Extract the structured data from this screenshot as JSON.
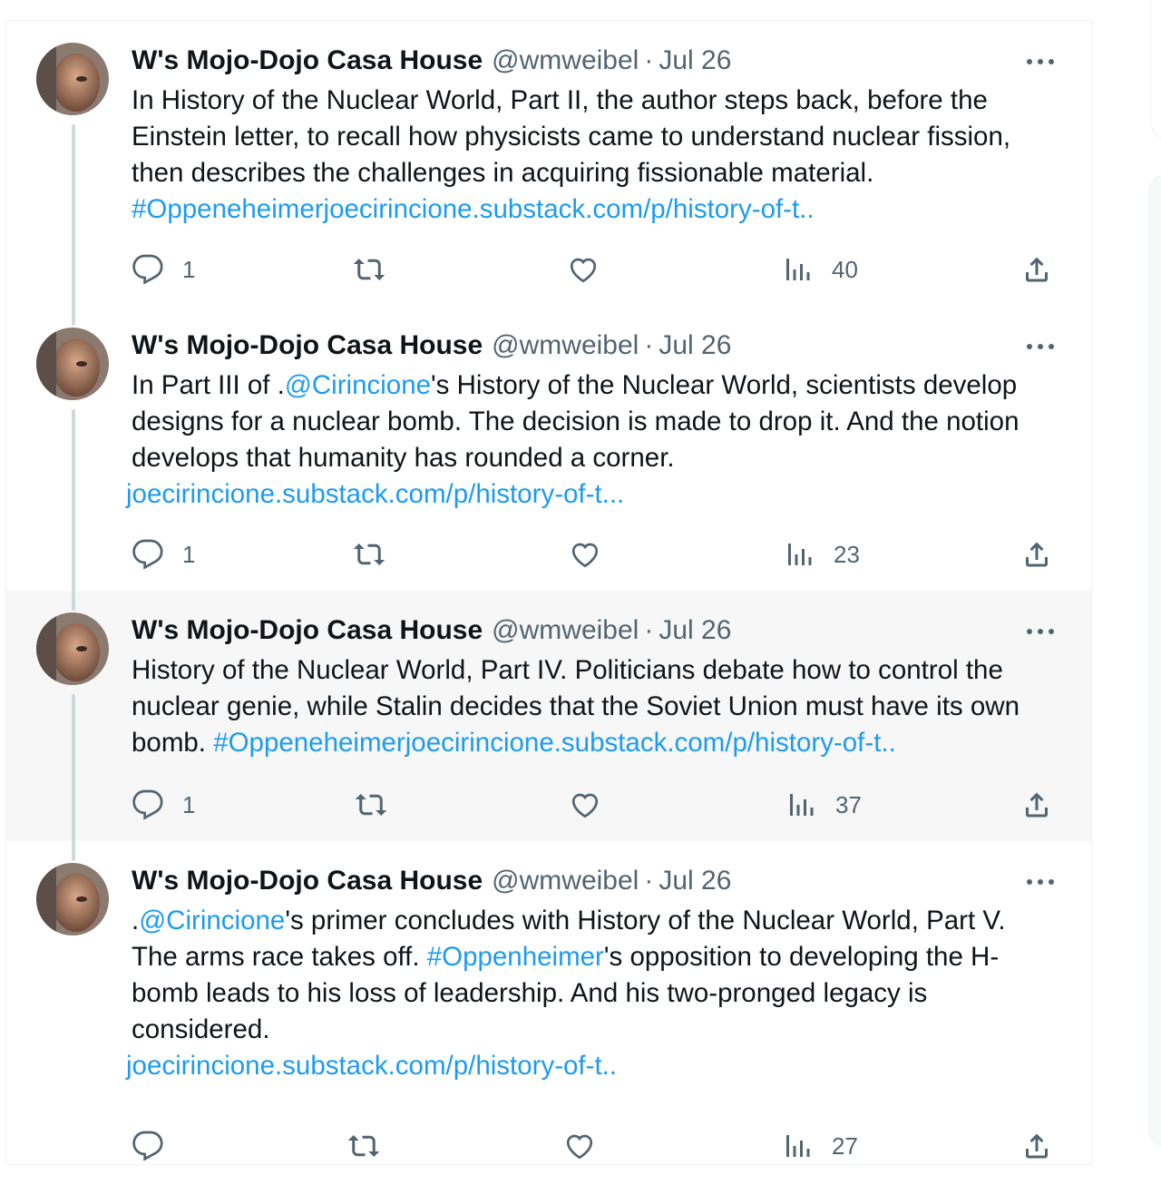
{
  "tweets": [
    {
      "name": "W's Mojo-Dojo Casa House",
      "handle": "@wmweibel",
      "separator": "·",
      "date": "Jul 26",
      "text_line1": "In History of the Nuclear World, Part II, the author steps back, before the",
      "text_line2": "Einstein letter, to recall how physicists came to understand nuclear fission,",
      "text_line3": "then describes the challenges in acquiring fissionable material.",
      "link_line": "#Oppeneheimerjoecirincione.substack.com/p/history-of-t..",
      "replies": "1",
      "views": "40"
    },
    {
      "name": "W's Mojo-Dojo Casa House",
      "handle": "@wmweibel",
      "separator": "·",
      "date": "Jul 26",
      "text_line1_pre": "In Part III of .",
      "text_line1_mention": "@Cirincione",
      "text_line1_post": "'s History of the Nuclear World, scientists develop",
      "text_line2": "designs for a nuclear bomb. The decision is made to drop it. And the notion",
      "text_line3": "develops that humanity has rounded a corner.",
      "link_line": "joecirincione.substack.com/p/history-of-t...",
      "replies": "1",
      "views": "23"
    },
    {
      "name": "W's Mojo-Dojo Casa House",
      "handle": "@wmweibel",
      "separator": "·",
      "date": "Jul 26",
      "text_line1": "History of the Nuclear World, Part IV. Politicians debate how to control the",
      "text_line2": "nuclear genie, while Stalin decides that the Soviet Union must have its own",
      "text_line3_pre": "bomb. ",
      "link_line": "#Oppeneheimerjoecirincione.substack.com/p/history-of-t..",
      "replies": "1",
      "views": "37"
    },
    {
      "name": "W's Mojo-Dojo Casa House",
      "handle": "@wmweibel",
      "separator": "·",
      "date": "Jul 26",
      "text_line1_pre": ".",
      "text_line1_mention": "@Cirincione",
      "text_line1_post": "'s primer concludes with History of the Nuclear World, Part V.",
      "text_line2_pre": "The arms race takes off. ",
      "text_line2_hashtag": "#Oppenheimer",
      "text_line2_post": "'s opposition to developing the H-",
      "text_line3": "bomb leads to his loss of leadership. And his two-pronged legacy is",
      "text_line4": "considered.",
      "link_line": "joecirincione.substack.com/p/history-of-t..",
      "views": "27"
    }
  ],
  "icons": {
    "reply": "reply-icon",
    "retweet": "retweet-icon",
    "like": "heart-icon",
    "views": "views-icon",
    "share": "share-icon",
    "more": "more-icon"
  },
  "colors": {
    "link": "#1d9bf0",
    "secondary_text": "#536471",
    "thread_line": "#cfd9de",
    "highlight_bg": "#f7f7f7"
  }
}
